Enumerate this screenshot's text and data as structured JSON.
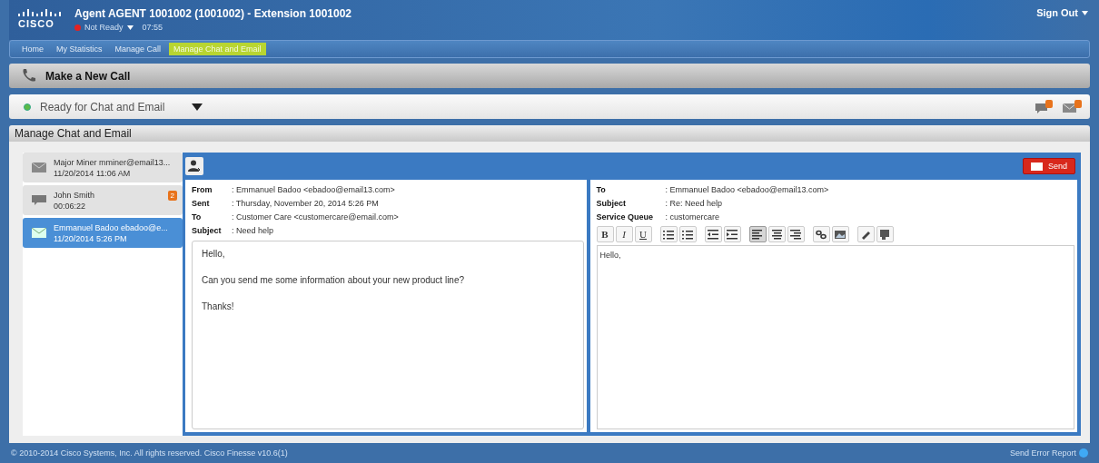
{
  "header": {
    "logo": "CISCO",
    "title": "Agent AGENT 1001002 (1001002) - Extension 1001002",
    "agent_state": "Not Ready",
    "state_timer": "07:55",
    "sign_out": "Sign Out"
  },
  "nav_tabs": [
    {
      "label": "Home",
      "selected": false
    },
    {
      "label": "My Statistics",
      "selected": false
    },
    {
      "label": "Manage Call",
      "selected": false
    },
    {
      "label": "Manage Chat and Email",
      "selected": true
    }
  ],
  "make_call": {
    "label": "Make a New Call"
  },
  "media_state": {
    "label": "Ready for Chat and Email"
  },
  "section_title": "Manage Chat and Email",
  "conversations": [
    {
      "kind": "email",
      "name": "Major Miner mminer@email13...",
      "time": "11/20/2014 11:06 AM",
      "selected": false
    },
    {
      "kind": "chat",
      "name": "John Smith",
      "time": "00:06:22",
      "badge": "2",
      "selected": false
    },
    {
      "kind": "email",
      "name": "Emmanuel Badoo ebadoo@e...",
      "time": "11/20/2014 5:26 PM",
      "selected": true
    }
  ],
  "send_button": "Send",
  "incoming": {
    "fields": [
      {
        "label": "From",
        "value": ": Emmanuel Badoo <ebadoo@email13.com>"
      },
      {
        "label": "Sent",
        "value": ": Thursday, November 20, 2014 5:26 PM"
      },
      {
        "label": "To",
        "value": ": Customer Care <customercare@email.com>"
      },
      {
        "label": "Subject",
        "value": ": Need help"
      }
    ],
    "body": [
      "Hello,",
      "Can you send me some information about your new product line?",
      "Thanks!"
    ]
  },
  "reply": {
    "fields": [
      {
        "label": "To",
        "value": ": Emmanuel Badoo <ebadoo@email13.com>"
      },
      {
        "label": "Subject",
        "value": ": Re: Need help"
      },
      {
        "label": "Service Queue",
        "value": ": customercare"
      }
    ],
    "text_buttons": [
      {
        "label": "B",
        "selected": false
      },
      {
        "label": "I",
        "selected": false
      },
      {
        "label": "U",
        "selected": false
      }
    ],
    "icon_buttons": [
      {
        "selected": false
      },
      {
        "selected": false
      },
      {
        "selected": false
      },
      {
        "selected": false
      },
      {
        "selected": true
      },
      {
        "selected": false
      },
      {
        "selected": false
      },
      {
        "selected": false
      },
      {
        "selected": false
      },
      {
        "selected": false
      },
      {
        "selected": false
      }
    ],
    "body": "Hello,"
  },
  "footer": {
    "copyright": "© 2010-2014 Cisco Systems, Inc. All rights reserved. Cisco Finesse v10.6(1)",
    "error_report": "Send Error Report"
  }
}
